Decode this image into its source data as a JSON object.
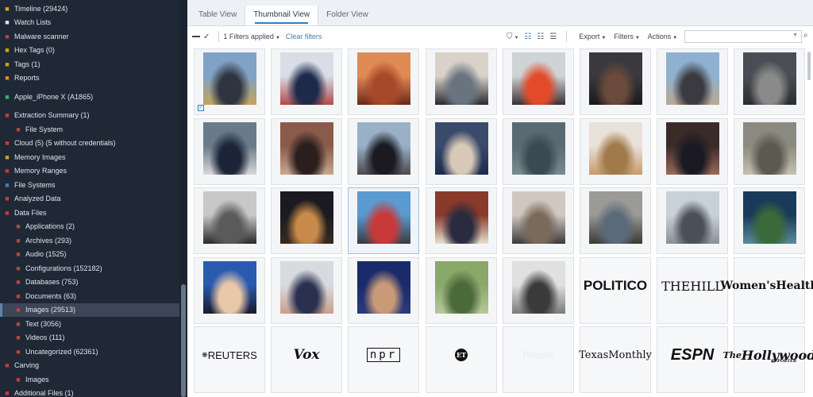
{
  "sidebar": {
    "items": [
      {
        "label": "Timeline (29424)",
        "icon": "clock-icon",
        "indent": 0,
        "color": "#e0a030"
      },
      {
        "label": "Watch Lists",
        "icon": "list-icon",
        "indent": 0,
        "color": "#dfe5ee"
      },
      {
        "label": "Malware scanner",
        "icon": "shield-icon",
        "indent": 0,
        "color": "#c04040"
      },
      {
        "label": "Hex Tags (0)",
        "icon": "hex-icon",
        "indent": 0,
        "color": "#d4a020"
      },
      {
        "label": "Tags (1)",
        "icon": "tag-icon",
        "indent": 0,
        "color": "#d4a020"
      },
      {
        "label": "Reports",
        "icon": "report-icon",
        "indent": 0,
        "color": "#e08a30"
      },
      {
        "label": "Apple_iPhone X (A1865)",
        "icon": "phone-icon",
        "indent": 0,
        "color": "#3cb371",
        "gap": true
      },
      {
        "label": "Extraction Summary (1)",
        "icon": "summary-icon",
        "indent": 0,
        "color": "#c04040",
        "gap": true
      },
      {
        "label": "File System",
        "icon": "folder-icon",
        "indent": 1,
        "color": "#c04040"
      },
      {
        "label": "Cloud (5)  (5 without credentials)",
        "icon": "cloud-icon",
        "indent": 0,
        "color": "#c04040"
      },
      {
        "label": "Memory Images",
        "icon": "memory-icon",
        "indent": 0,
        "color": "#d4a020"
      },
      {
        "label": "Memory Ranges",
        "icon": "memory-range-icon",
        "indent": 0,
        "color": "#c04040"
      },
      {
        "label": "File Systems",
        "icon": "filesystem-icon",
        "indent": 0,
        "color": "#3f7ec0"
      },
      {
        "label": "Analyzed Data",
        "icon": "analyzed-icon",
        "indent": 0,
        "color": "#c04040"
      },
      {
        "label": "Data Files",
        "icon": "datafiles-icon",
        "indent": 0,
        "color": "#c04040"
      },
      {
        "label": "Applications (2)",
        "icon": "app-icon",
        "indent": 1,
        "color": "#c04040"
      },
      {
        "label": "Archives (293)",
        "icon": "archive-icon",
        "indent": 1,
        "color": "#c04040"
      },
      {
        "label": "Audio (1525)",
        "icon": "audio-icon",
        "indent": 1,
        "color": "#c04040"
      },
      {
        "label": "Configurations (152182)",
        "icon": "config-icon",
        "indent": 1,
        "color": "#c04040"
      },
      {
        "label": "Databases (753)",
        "icon": "database-icon",
        "indent": 1,
        "color": "#c04040"
      },
      {
        "label": "Documents (63)",
        "icon": "document-icon",
        "indent": 1,
        "color": "#c04040"
      },
      {
        "label": "Images (29513)",
        "icon": "image-icon",
        "indent": 1,
        "color": "#c04040",
        "selected": true
      },
      {
        "label": "Text (3056)",
        "icon": "text-icon",
        "indent": 1,
        "color": "#c04040"
      },
      {
        "label": "Videos (111)",
        "icon": "video-icon",
        "indent": 1,
        "color": "#c04040"
      },
      {
        "label": "Uncategorized (62361)",
        "icon": "uncategorized-icon",
        "indent": 1,
        "color": "#c04040"
      },
      {
        "label": "Carving",
        "icon": "carving-icon",
        "indent": 0,
        "color": "#c04040"
      },
      {
        "label": "Images",
        "icon": "image-icon",
        "indent": 1,
        "color": "#c04040"
      },
      {
        "label": "Additional Files (1)",
        "icon": "files-icon",
        "indent": 0,
        "color": "#c04040"
      }
    ]
  },
  "tabs": [
    {
      "label": "Table View",
      "active": false
    },
    {
      "label": "Thumbnail View",
      "active": true
    },
    {
      "label": "Folder View",
      "active": false
    }
  ],
  "toolbar": {
    "filters_applied": "1 Filters applied",
    "clear_filters": "Clear filters",
    "export": "Export",
    "filters": "Filters",
    "actions": "Actions",
    "search_placeholder": ""
  },
  "thumbnails": [
    {
      "kind": "photo",
      "colors": [
        "#7fa2c6",
        "#2e3440",
        "#c4a35a"
      ],
      "checked": true
    },
    {
      "kind": "photo",
      "colors": [
        "#d8dde6",
        "#1d2a4a",
        "#b04a4a"
      ]
    },
    {
      "kind": "photo",
      "colors": [
        "#e08a55",
        "#a8482a",
        "#6a2818"
      ]
    },
    {
      "kind": "photo",
      "colors": [
        "#d9d2c8",
        "#6a7480",
        "#2a2a30"
      ]
    },
    {
      "kind": "photo",
      "colors": [
        "#cfd3d6",
        "#e24a2a",
        "#3a3034"
      ]
    },
    {
      "kind": "photo",
      "colors": [
        "#3a3a3e",
        "#6a4a3a",
        "#1a1a1e"
      ]
    },
    {
      "kind": "photo",
      "colors": [
        "#8fb0d0",
        "#3a3a40",
        "#b8a890"
      ]
    },
    {
      "kind": "photo",
      "colors": [
        "#4a4e54",
        "#8a8a8a",
        "#2a2c30"
      ]
    },
    {
      "kind": "photo",
      "colors": [
        "#6a7a8a",
        "#1c2438",
        "#d8d8d8"
      ]
    },
    {
      "kind": "photo",
      "colors": [
        "#8a5a4a",
        "#2a1e1e",
        "#c8a890"
      ]
    },
    {
      "kind": "photo",
      "colors": [
        "#9ab0c8",
        "#1a1a20",
        "#4a4a4e"
      ]
    },
    {
      "kind": "photo",
      "colors": [
        "#3a4a6a",
        "#d8c8b8",
        "#1a2a4a"
      ]
    },
    {
      "kind": "photo",
      "colors": [
        "#5a6a72",
        "#3a4a52",
        "#7a8a90"
      ]
    },
    {
      "kind": "photo",
      "colors": [
        "#e8e2da",
        "#a07a4a",
        "#c89a6a"
      ]
    },
    {
      "kind": "photo",
      "colors": [
        "#3a2a28",
        "#1a1a24",
        "#9a6a5a"
      ]
    },
    {
      "kind": "photo",
      "colors": [
        "#8a8a80",
        "#5a5a50",
        "#c8c0b0"
      ]
    },
    {
      "kind": "photo",
      "colors": [
        "#c8c8c8",
        "#5a5a5a",
        "#2a2a2a"
      ]
    },
    {
      "kind": "photo",
      "colors": [
        "#1a1a20",
        "#c88a4a",
        "#3a2a20"
      ]
    },
    {
      "kind": "photo",
      "colors": [
        "#5a9ad0",
        "#c83a3a",
        "#3a3a40"
      ],
      "hover": true
    },
    {
      "kind": "photo",
      "colors": [
        "#8a3a2a",
        "#2a2a40",
        "#e8e0d0"
      ]
    },
    {
      "kind": "photo",
      "colors": [
        "#d0c8c0",
        "#7a6a5a",
        "#3a3a3a"
      ]
    },
    {
      "kind": "photo",
      "colors": [
        "#9a9a96",
        "#5a6a7a",
        "#3a3a34"
      ]
    },
    {
      "kind": "photo",
      "colors": [
        "#c8d0d8",
        "#4a5058",
        "#8a9098"
      ]
    },
    {
      "kind": "photo",
      "colors": [
        "#1a3a5a",
        "#3a6a3a",
        "#5a8a9a"
      ]
    },
    {
      "kind": "photo",
      "colors": [
        "#2a5ab0",
        "#e8c8a8",
        "#1a1a2a"
      ]
    },
    {
      "kind": "photo",
      "colors": [
        "#d8dae0",
        "#2a3050",
        "#c8a088"
      ]
    },
    {
      "kind": "photo",
      "colors": [
        "#1a2a6a",
        "#c89a78",
        "#2a3a7a"
      ]
    },
    {
      "kind": "photo",
      "colors": [
        "#8aa86a",
        "#4a6a3a",
        "#b8c89a"
      ]
    },
    {
      "kind": "photo",
      "colors": [
        "#e0e0e0",
        "#3a3a3a",
        "#7a7a7a"
      ]
    },
    {
      "kind": "logo",
      "text": "POLITICO",
      "font": "sans",
      "size": 17,
      "weight": "700"
    },
    {
      "kind": "logo",
      "text": "THEHILL",
      "font": "serif",
      "size": 16,
      "weight": "400"
    },
    {
      "kind": "logo",
      "text": "Women'sHealth",
      "font": "serif",
      "size": 14,
      "weight": "700"
    },
    {
      "kind": "logo",
      "text": "REUTERS",
      "font": "sans",
      "size": 13,
      "weight": "400",
      "prefix": "❋ "
    },
    {
      "kind": "logo",
      "text": "Vox",
      "font": "serif",
      "size": 17,
      "weight": "700",
      "italic": true
    },
    {
      "kind": "logo",
      "text": "npr",
      "font": "mono",
      "size": 14,
      "weight": "400",
      "boxed": true
    },
    {
      "kind": "logo",
      "text": "ET",
      "font": "serif",
      "size": 8,
      "weight": "700",
      "circle": true
    },
    {
      "kind": "logo",
      "text": "People",
      "font": "sans",
      "size": 12,
      "weight": "700",
      "faint": true
    },
    {
      "kind": "logo",
      "text": "TexasMonthly",
      "font": "serif",
      "size": 13,
      "weight": "400"
    },
    {
      "kind": "logo",
      "text": "ESPN",
      "font": "sans",
      "size": 20,
      "weight": "700",
      "italic": true
    },
    {
      "kind": "logo",
      "text": "Hollywood",
      "font": "serif",
      "size": 16,
      "weight": "700",
      "italic": true,
      "prefix": "The ",
      "suffix": "REPORTER"
    }
  ]
}
